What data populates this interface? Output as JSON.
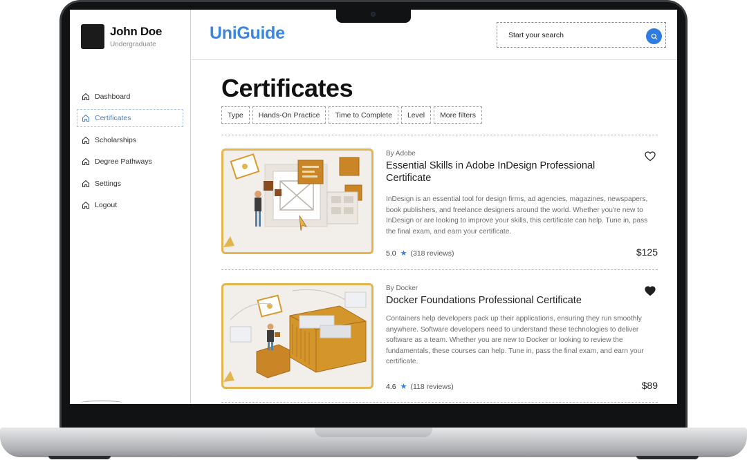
{
  "user": {
    "name": "John Doe",
    "role": "Undergraduate"
  },
  "nav": [
    {
      "label": "Dashboard"
    },
    {
      "label": "Certificates"
    },
    {
      "label": "Scholarships"
    },
    {
      "label": "Degree Pathways"
    },
    {
      "label": "Settings"
    },
    {
      "label": "Logout"
    }
  ],
  "header": {
    "logo": "UniGuide",
    "search_placeholder": "Start your search"
  },
  "page": {
    "title": "Certificates"
  },
  "filters": [
    "Type",
    "Hands-On Practice",
    "Time to Complete",
    "Level",
    "More filters"
  ],
  "courses": [
    {
      "provider": "By Adobe",
      "title": "Essential Skills in Adobe InDesign Professional Certificate",
      "description": "InDesign is an essential tool for design firms, ad agencies, magazines, newspapers, book publishers, and freelance designers around the world. Whether you're new to InDesign or are looking to improve your skills, this certificate can help. Tune in, pass the final exam, and earn your certificate.",
      "rating": "5.0",
      "reviews": "(318 reviews)",
      "price": "$125",
      "favorited": false
    },
    {
      "provider": "By Docker",
      "title": "Docker Foundations Professional Certificate",
      "description": "Containers help developers pack up their applications, ensuring they run smoothly anywhere. Software developers need to understand these technologies to deliver software as a team. Whether you are new to Docker or looking to review the fundamentals, these courses can help. Tune in, pass the final exam, and earn your certificate.",
      "rating": "4.6",
      "reviews": "(118 reviews)",
      "price": "$89",
      "favorited": true
    }
  ],
  "colors": {
    "accent": "#3a86e0",
    "search_button": "#2f7be0",
    "thumb_border": "#e3b54f",
    "thumb_fill": "#d89a2c"
  },
  "icons": {
    "nav": "home-icon",
    "search": "search-icon",
    "favorite": "heart-icon",
    "rating": "star-icon"
  }
}
